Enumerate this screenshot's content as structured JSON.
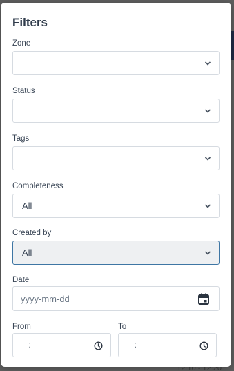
{
  "background": {
    "partial_text": "12:10 - 12:20"
  },
  "modal": {
    "title": "Filters",
    "fields": {
      "zone": {
        "label": "Zone",
        "value": ""
      },
      "status": {
        "label": "Status",
        "value": ""
      },
      "tags": {
        "label": "Tags",
        "value": ""
      },
      "completeness": {
        "label": "Completeness",
        "value": "All"
      },
      "created_by": {
        "label": "Created by",
        "value": "All"
      },
      "date": {
        "label": "Date",
        "placeholder": "yyyy-mm-dd"
      },
      "from": {
        "label": "From",
        "value": "--:--"
      },
      "to": {
        "label": "To",
        "value": "--:--"
      }
    },
    "icons": {
      "select": "chevron-down-icon",
      "date": "calendar-icon",
      "time": "clock-icon"
    },
    "colors": {
      "title": "#2f3b4b",
      "focused_border": "#3e76a4",
      "focused_bg": "#eef0f2"
    }
  }
}
